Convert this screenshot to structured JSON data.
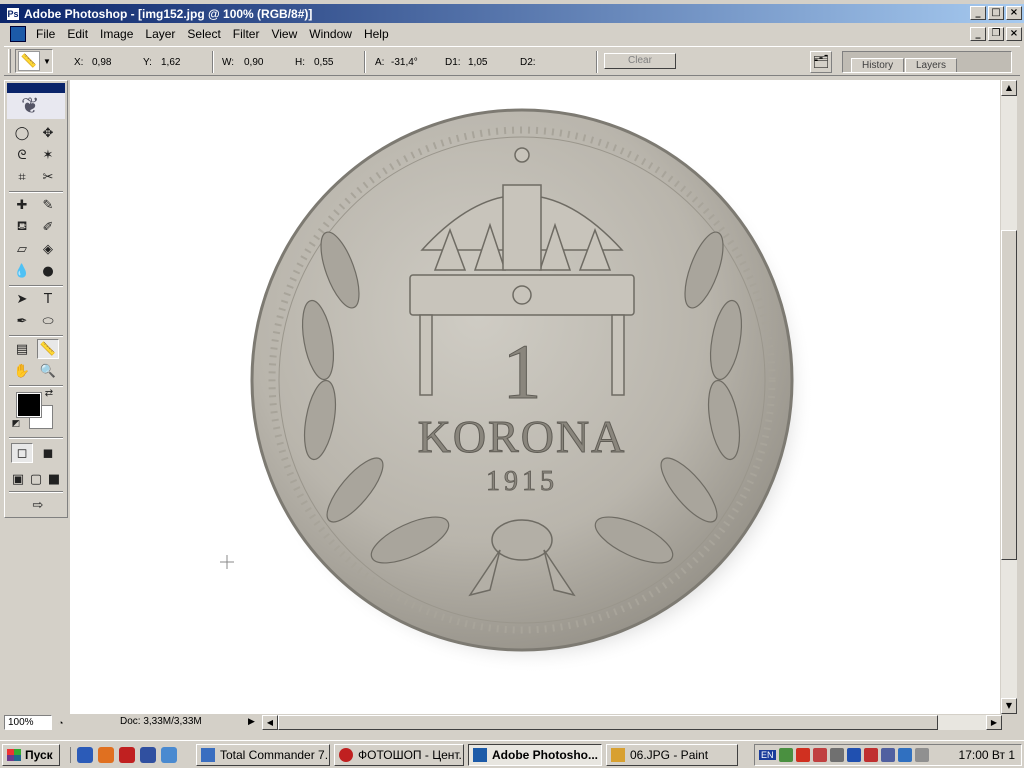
{
  "window": {
    "title": "Adobe Photoshop - [img152.jpg @ 100% (RGB/8#)]"
  },
  "menu": {
    "items": [
      "File",
      "Edit",
      "Image",
      "Layer",
      "Select",
      "Filter",
      "View",
      "Window",
      "Help"
    ]
  },
  "options": {
    "x_label": "X:",
    "x_value": "0,98",
    "y_label": "Y:",
    "y_value": "1,62",
    "w_label": "W:",
    "w_value": "0,90",
    "h_label": "H:",
    "h_value": "0,55",
    "a_label": "A:",
    "a_value": "-31,4°",
    "d1_label": "D1:",
    "d1_value": "1,05",
    "d2_label": "D2:",
    "clear_label": "Clear"
  },
  "palette_well": {
    "tabs": [
      "History",
      "Layers"
    ]
  },
  "coin": {
    "denomination": "1",
    "word": "KORONA",
    "year": "1915",
    "colors": {
      "metal": "#b9b5ac",
      "rim": "#8f8b82"
    }
  },
  "status": {
    "zoom": "100%",
    "doc": "Doc: 3,33M/3,33M"
  },
  "taskbar": {
    "start_label": "Пуск",
    "tasks": [
      "Total Commander 7...",
      "ФОТОШОП - Цент...",
      "Adobe Photosho...",
      "06.JPG - Paint"
    ],
    "lang": "EN",
    "clock": "17:00 Вт 1"
  },
  "colors": {
    "title_start": "#0a246a",
    "title_end": "#a6caf0",
    "face": "#d4d0c8"
  }
}
